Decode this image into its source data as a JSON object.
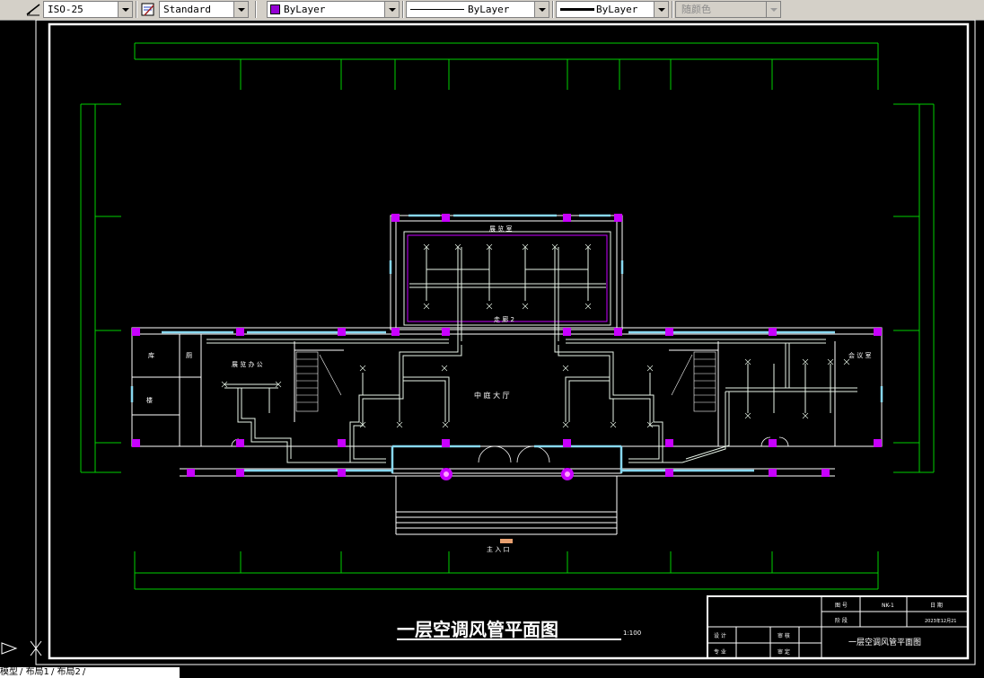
{
  "toolbar": {
    "dimstyle": "ISO-25",
    "textstyle": "Standard",
    "layer_color": "ByLayer",
    "linetype": "ByLayer",
    "lineweight": "ByLayer",
    "plotstyle": "随颜色",
    "color_swatch": "#9400d3"
  },
  "drawing": {
    "title": "一层空调风管平面图",
    "scale": "1:100",
    "rooms": {
      "top_room": "展 览 室",
      "top_corridor": "走 廊 2",
      "hall": "中 庭 大 厅",
      "left_room": "展 览 办 公",
      "right_room": "会 议 室",
      "left_small_1": "库",
      "left_small_2": "厕",
      "left_small_3": "楼",
      "entrance": "主 入 口"
    },
    "title_block": {
      "drawing_no_label": "图 号",
      "drawing_no_value": "NK-1",
      "date_label": "日 期",
      "stage_label": "阶 段",
      "date_value": "2023年12月21",
      "name": "一层空调风管平面图",
      "designer_label": "设 计",
      "checker_label": "审 核",
      "major_label": "专 业",
      "approver_label": "审 定"
    }
  },
  "layout_tabs": [
    "模型",
    "布局1",
    "布局2"
  ],
  "colors": {
    "background": "#000000",
    "duct": "#e8f4e8",
    "magenta": "#c800ff",
    "wall_cyan": "#88d8f0",
    "grid_green": "#00d000"
  }
}
